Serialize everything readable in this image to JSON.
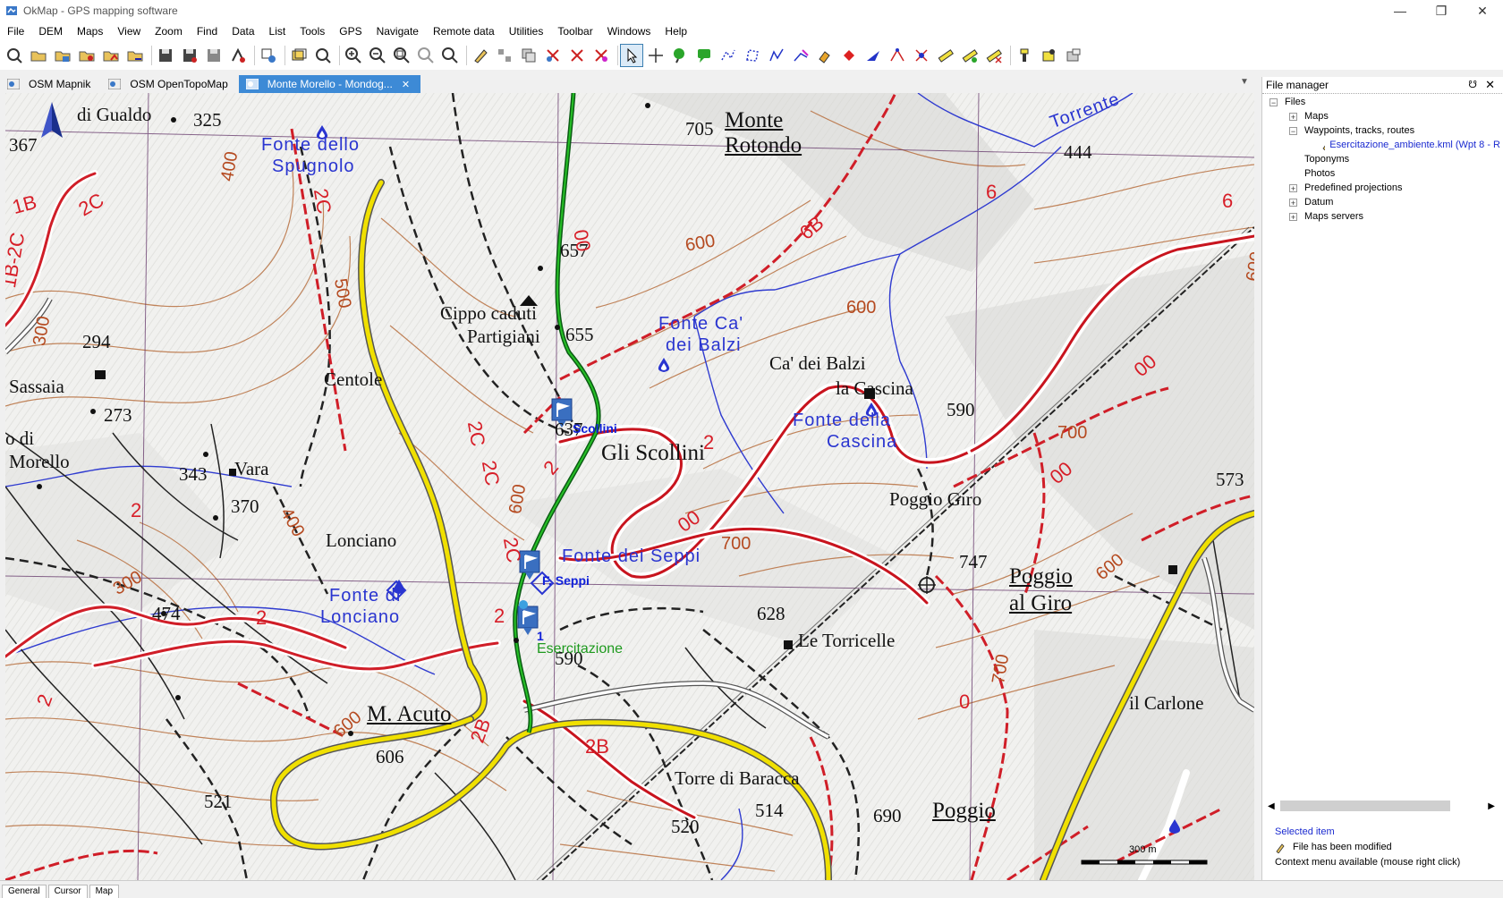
{
  "window": {
    "title": "OkMap - GPS mapping software"
  },
  "menu": [
    "File",
    "DEM",
    "Maps",
    "View",
    "Zoom",
    "Find",
    "Data",
    "List",
    "Tools",
    "GPS",
    "Navigate",
    "Remote data",
    "Utilities",
    "Toolbar",
    "Windows",
    "Help"
  ],
  "tabs": [
    {
      "label": "OSM Mapnik",
      "active": false
    },
    {
      "label": "OSM OpenTopoMap",
      "active": false
    },
    {
      "label": "Monte Morello - Mondog...",
      "active": true
    }
  ],
  "map": {
    "points": [
      {
        "t": "di Gualdo",
        "c": "pt"
      },
      {
        "t": "325",
        "c": "pt"
      },
      {
        "t": "367",
        "c": "pt"
      },
      {
        "t": "705",
        "c": "pt"
      },
      {
        "t": "Monte",
        "c": "big"
      },
      {
        "t": "Rotondo",
        "c": "big"
      },
      {
        "t": "444",
        "c": "pt"
      },
      {
        "t": "657",
        "c": "pt"
      },
      {
        "t": "Cippo caduti",
        "c": "pt"
      },
      {
        "t": "Partigiani",
        "c": "pt"
      },
      {
        "t": "655",
        "c": "pt"
      },
      {
        "t": "294",
        "c": "pt"
      },
      {
        "t": "Sassaia",
        "c": "pt"
      },
      {
        "t": "Centole",
        "c": "pt"
      },
      {
        "t": "273",
        "c": "pt"
      },
      {
        "t": "o di",
        "c": "pt"
      },
      {
        "t": "Morello",
        "c": "pt"
      },
      {
        "t": "637",
        "c": "pt"
      },
      {
        "t": "Gli Scollini",
        "c": "big"
      },
      {
        "t": "Ca' dei Balzi",
        "c": "pt"
      },
      {
        "t": "la Cascina",
        "c": "pt"
      },
      {
        "t": "590",
        "c": "pt"
      },
      {
        "t": "343",
        "c": "pt"
      },
      {
        "t": "Vara",
        "c": "pt"
      },
      {
        "t": "370",
        "c": "pt"
      },
      {
        "t": "Poggio Giro",
        "c": "pt"
      },
      {
        "t": "573",
        "c": "pt"
      },
      {
        "t": "Lonciano",
        "c": "pt"
      },
      {
        "t": "747",
        "c": "pt"
      },
      {
        "t": "Poggio",
        "c": "big"
      },
      {
        "t": "al Giro",
        "c": "big"
      },
      {
        "t": "474",
        "c": "pt"
      },
      {
        "t": "628",
        "c": "pt"
      },
      {
        "t": "Le Torricelle",
        "c": "pt"
      },
      {
        "t": "590",
        "c": "pt"
      },
      {
        "t": "M. Acuto",
        "c": "big"
      },
      {
        "t": "il Carlone",
        "c": "pt"
      },
      {
        "t": "606",
        "c": "pt"
      },
      {
        "t": "Torre di Baracca",
        "c": "pt"
      },
      {
        "t": "521",
        "c": "pt"
      },
      {
        "t": "520",
        "c": "pt"
      },
      {
        "t": "514",
        "c": "pt"
      },
      {
        "t": "690",
        "c": "pt"
      },
      {
        "t": "Poggio",
        "c": "big"
      }
    ],
    "water": [
      {
        "t": "Fonte dello"
      },
      {
        "t": "Spugnolo"
      },
      {
        "t": "Fonte Ca'"
      },
      {
        "t": "dei Balzi"
      },
      {
        "t": "Fonte della"
      },
      {
        "t": "Cascina"
      },
      {
        "t": "Fonte di"
      },
      {
        "t": "Lonciano"
      },
      {
        "t": "Fonte dei Seppi"
      },
      {
        "t": "Torrente"
      }
    ],
    "contours": [
      "400",
      "2C",
      "1B",
      "2C",
      "1B-2C",
      "300",
      "500",
      "300",
      "600",
      "6B",
      "600",
      "600",
      "6",
      "00",
      "700",
      "00",
      "2C",
      "2C",
      "600",
      "400",
      "00",
      "700",
      "600",
      "2C",
      "00",
      "700",
      "0",
      "600"
    ],
    "red_labels": [
      "2",
      "2",
      "2",
      "2",
      "2",
      "2",
      "2B",
      "2B",
      "6"
    ],
    "waypoints": [
      {
        "name": "Scollini"
      },
      {
        "name": "F. Seppi"
      },
      {
        "name": "1"
      }
    ],
    "track_label": "Esercitazione",
    "scale": "300 m"
  },
  "file_manager": {
    "title": "File manager",
    "tree": [
      {
        "label": "Files",
        "level": 0,
        "exp": "-"
      },
      {
        "label": "Maps",
        "level": 1,
        "exp": "+"
      },
      {
        "label": "Waypoints, tracks, routes",
        "level": 1,
        "exp": "-"
      },
      {
        "label": "Esercitazione_ambiente.kml (Wpt 8 - R",
        "level": 2,
        "exp": "",
        "link": true
      },
      {
        "label": "Toponyms",
        "level": 1,
        "exp": ""
      },
      {
        "label": "Photos",
        "level": 1,
        "exp": ""
      },
      {
        "label": "Predefined projections",
        "level": 1,
        "exp": "+"
      },
      {
        "label": "Datum",
        "level": 1,
        "exp": "+"
      },
      {
        "label": "Maps servers",
        "level": 1,
        "exp": "+"
      }
    ],
    "info_title": "Selected item",
    "info_modified": "File has been modified",
    "info_context": "Context menu available (mouse right click)"
  },
  "status_tabs": [
    "General",
    "Cursor",
    "Map"
  ]
}
